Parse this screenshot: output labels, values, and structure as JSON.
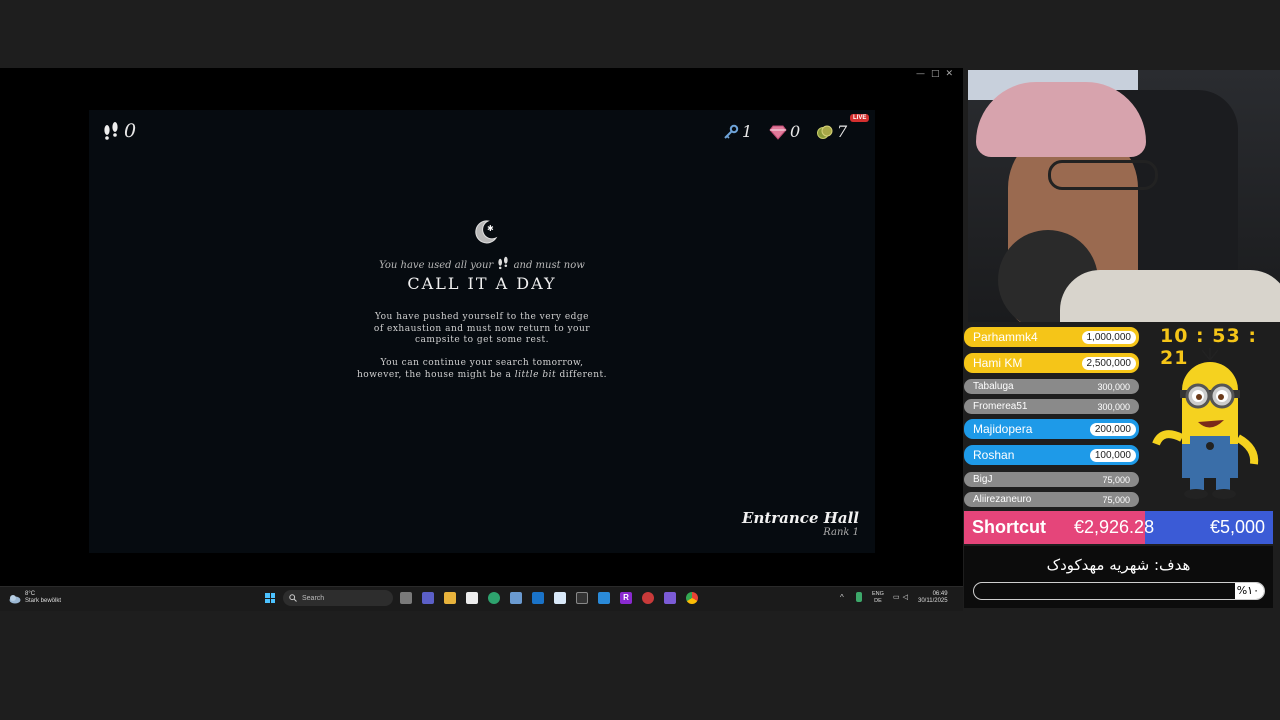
{
  "game": {
    "steps": "0",
    "keys": "1",
    "gems": "0",
    "coins": "7",
    "live_badge": "LIVE",
    "used_prefix": "You have used all your",
    "used_suffix": "and must now",
    "heading": "CALL IT A DAY",
    "para1_line1": "You have pushed yourself to the very edge",
    "para1_line2": "of exhaustion and must now return to your",
    "para1_line3": "campsite to get some rest.",
    "para2_line1": "You can continue your search tomorrow,",
    "para2_line2_a": "however, the house might be a",
    "para2_line2_em": "little bit",
    "para2_line2_b": "different.",
    "room_name": "Entrance Hall",
    "room_rank": "Rank 1"
  },
  "taskbar": {
    "weather_temp": "8°C",
    "weather_desc": "Stark bewölkt",
    "search_placeholder": "Search",
    "lang_top": "ENG",
    "lang_bottom": "DE",
    "time": "06:49",
    "date": "30/11/2025"
  },
  "overlay": {
    "timer": "10 : 53 : 21",
    "donors": [
      {
        "name": "Parhammk4",
        "amount": "1,000,000",
        "color": "#f5c518"
      },
      {
        "name": "Hami KM",
        "amount": "2,500,000",
        "color": "#f5c518"
      },
      {
        "name": "Tabaluga",
        "amount": "300,000",
        "color": "#8a8a8a"
      },
      {
        "name": "Fromerea51",
        "amount": "300,000",
        "color": "#8a8a8a"
      },
      {
        "name": "Majidopera",
        "amount": "200,000",
        "color": "#1e9ae8"
      },
      {
        "name": "Roshan",
        "amount": "100,000",
        "color": "#1e9ae8"
      },
      {
        "name": "BigJ",
        "amount": "75,000",
        "color": "#8a8a8a"
      },
      {
        "name": "Aliirezaneuro",
        "amount": "75,000",
        "color": "#8a8a8a"
      }
    ],
    "goal_label": "Shortcut",
    "goal_current": "€2,926.28",
    "goal_target": "€5,000",
    "goal_fraction": 0.585,
    "goal_color": "#e5457a",
    "goal_bg": "#3b5bd6",
    "target_text": "هدف: شهریه مهدکودک",
    "target_percent": "%۱۰",
    "target_fraction": 0.1
  }
}
